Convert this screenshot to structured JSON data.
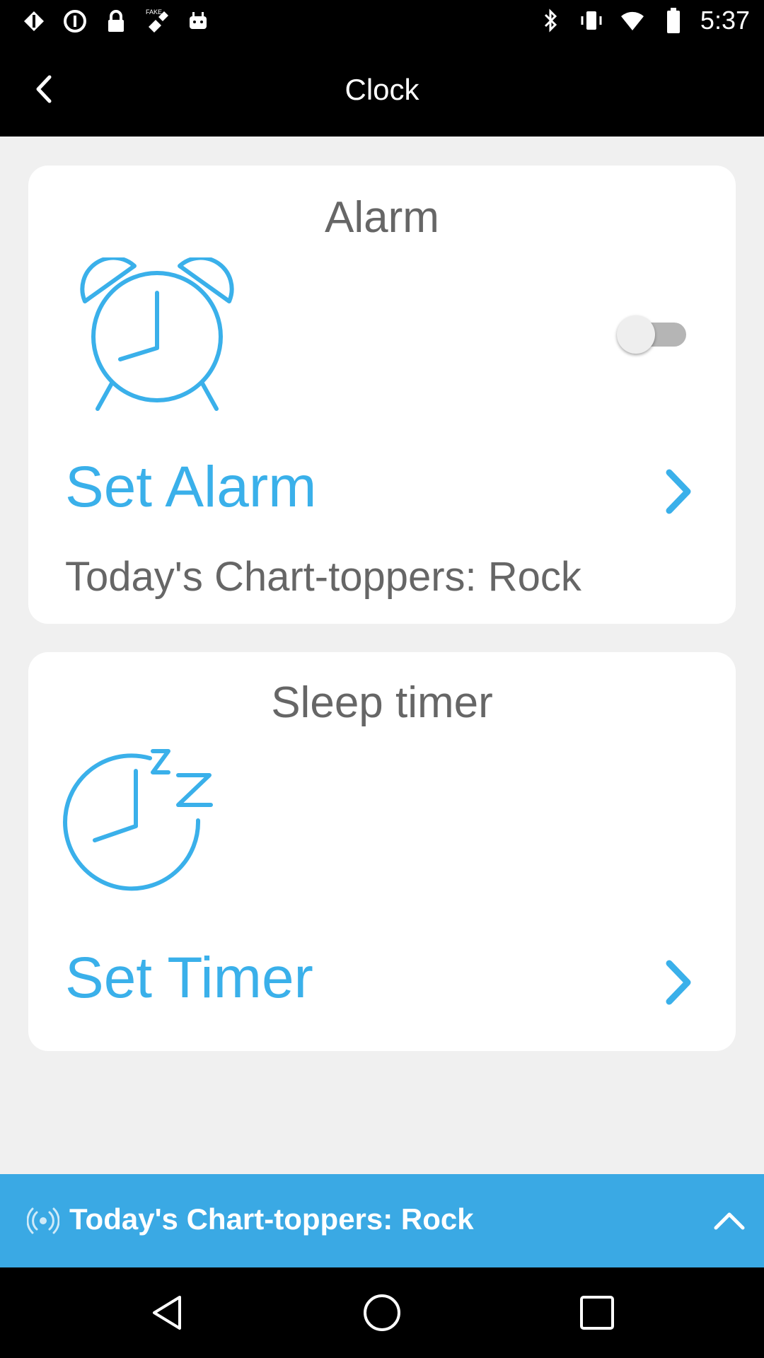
{
  "status_bar": {
    "time": "5:37",
    "left_icons": [
      "signal-icon",
      "block-icon",
      "lock-icon",
      "satellite-fake-icon",
      "android-icon"
    ],
    "right_icons": [
      "bluetooth-icon",
      "vibrate-icon",
      "wifi-icon",
      "battery-icon"
    ],
    "fake_badge": "FAKE"
  },
  "app_bar": {
    "title": "Clock",
    "back_icon": "back-chevron-icon"
  },
  "alarm_card": {
    "heading": "Alarm",
    "icon": "alarm-clock-icon",
    "toggle_on": false,
    "action_label": "Set Alarm",
    "subtitle": "Today's Chart-toppers: Rock"
  },
  "sleep_card": {
    "heading": "Sleep timer",
    "icon": "sleep-timer-icon",
    "action_label": "Set Timer"
  },
  "player": {
    "title": "Today's Chart-toppers: Rock",
    "left_icon": "radio-broadcast-icon",
    "right_icon": "chevron-up-icon"
  },
  "colors": {
    "accent": "#3ab0ea",
    "player_bg": "#3aa9e4",
    "page_bg": "#f0f0f0",
    "text_muted": "#666666"
  }
}
